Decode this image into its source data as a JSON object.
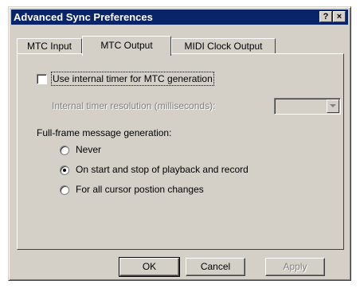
{
  "window": {
    "title": "Advanced Sync Preferences",
    "help_button": "?",
    "close_button": "×"
  },
  "tabs": [
    {
      "label": "MTC Input",
      "active": false
    },
    {
      "label": "MTC Output",
      "active": true
    },
    {
      "label": "MIDI Clock Output",
      "active": false
    }
  ],
  "mtc_output": {
    "use_internal_timer": {
      "label": "Use internal timer for MTC generation",
      "checked": false
    },
    "timer_resolution": {
      "label": "Internal timer resolution (milliseconds):",
      "value": "",
      "enabled": false
    },
    "fullframe_group_label": "Full-frame message generation:",
    "fullframe_options": [
      {
        "label": "Never",
        "selected": false
      },
      {
        "label": "On start and stop of playback and record",
        "selected": true
      },
      {
        "label": "For all cursor postion changes",
        "selected": false
      }
    ]
  },
  "buttons": {
    "ok": "OK",
    "cancel": "Cancel",
    "apply": "Apply"
  }
}
